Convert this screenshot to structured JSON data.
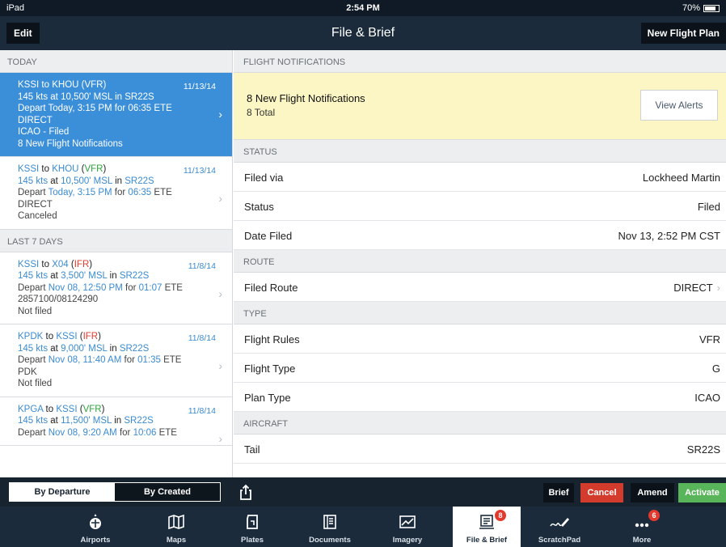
{
  "status_bar": {
    "device": "iPad",
    "time": "2:54 PM",
    "battery": "70%"
  },
  "nav": {
    "edit_label": "Edit",
    "title": "File & Brief",
    "new_flight_plan_label": "New Flight Plan"
  },
  "left": {
    "today_header": "TODAY",
    "last7_header": "LAST 7 DAYS",
    "today": [
      {
        "from": "KSSI",
        "to": "KHOU",
        "rules": "VFR",
        "date": "11/13/14",
        "speed": "145 kts",
        "alt": "10,500' MSL",
        "aircraft": "SR22S",
        "depart": "Today, 3:15 PM",
        "ete": "06:35",
        "route": "DIRECT",
        "line5": "ICAO - Filed",
        "line6": "8 New Flight Notifications"
      },
      {
        "from": "KSSI",
        "to": "KHOU",
        "rules": "VFR",
        "date": "11/13/14",
        "speed": "145 kts",
        "alt": "10,500' MSL",
        "aircraft": "SR22S",
        "depart": "Today, 3:15 PM",
        "ete": "06:35",
        "route": "DIRECT",
        "line5": "Canceled"
      }
    ],
    "last7": [
      {
        "from": "KSSI",
        "to": "X04",
        "rules": "IFR",
        "date": "11/8/14",
        "speed": "145 kts",
        "alt": "3,500' MSL",
        "aircraft": "SR22S",
        "depart": "Nov 08, 12:50 PM",
        "ete": "01:07",
        "route": "2857100/08124290",
        "line5": "Not filed"
      },
      {
        "from": "KPDK",
        "to": "KSSI",
        "rules": "IFR",
        "date": "11/8/14",
        "speed": "145 kts",
        "alt": "9,000' MSL",
        "aircraft": "SR22S",
        "depart": "Nov 08, 11:40 AM",
        "ete": "01:35",
        "route": "PDK",
        "line5": "Not filed"
      },
      {
        "from": "KPGA",
        "to": "KSSI",
        "rules": "VFR",
        "date": "11/8/14",
        "speed": "145 kts",
        "alt": "11,500' MSL",
        "aircraft": "SR22S",
        "depart": "Nov 08, 9:20 AM",
        "ete": "10:06"
      }
    ],
    "words": {
      "to": "to",
      "at": "at",
      "in": "in",
      "depart": "Depart",
      "for": "for",
      "ete": "ETE"
    }
  },
  "right": {
    "notifications_header": "FLIGHT NOTIFICATIONS",
    "notice_title": "8 New Flight Notifications",
    "notice_sub": "8 Total",
    "view_alerts_label": "View Alerts",
    "status_header": "STATUS",
    "filed_via": {
      "label": "Filed via",
      "value": "Lockheed Martin"
    },
    "status": {
      "label": "Status",
      "value": "Filed"
    },
    "date_filed": {
      "label": "Date Filed",
      "value": "Nov 13, 2:52 PM CST"
    },
    "route_header": "ROUTE",
    "filed_route": {
      "label": "Filed Route",
      "value": "DIRECT"
    },
    "type_header": "TYPE",
    "flight_rules": {
      "label": "Flight Rules",
      "value": "VFR"
    },
    "flight_type": {
      "label": "Flight Type",
      "value": "G"
    },
    "plan_type": {
      "label": "Plan Type",
      "value": "ICAO"
    },
    "aircraft_header": "AIRCRAFT",
    "tail": {
      "label": "Tail",
      "value": "SR22S"
    }
  },
  "toolbar": {
    "by_departure": "By Departure",
    "by_created": "By Created",
    "brief": "Brief",
    "cancel": "Cancel",
    "amend": "Amend",
    "activate": "Activate"
  },
  "tabs": [
    {
      "label": "Airports",
      "icon": "airport-icon"
    },
    {
      "label": "Maps",
      "icon": "map-icon"
    },
    {
      "label": "Plates",
      "icon": "plates-icon"
    },
    {
      "label": "Documents",
      "icon": "documents-icon"
    },
    {
      "label": "Imagery",
      "icon": "imagery-icon"
    },
    {
      "label": "File & Brief",
      "icon": "file-brief-icon",
      "badge": "8"
    },
    {
      "label": "ScratchPad",
      "icon": "scratchpad-icon"
    },
    {
      "label": "More",
      "icon": "more-icon",
      "badge": "6"
    }
  ],
  "colors": {
    "accent": "#3b8fd9",
    "vfr": "#2fa53a",
    "ifr": "#e23a2e",
    "notice_bg": "#fbf6c4",
    "cancel": "#d33b2c",
    "activate": "#59b55a"
  }
}
